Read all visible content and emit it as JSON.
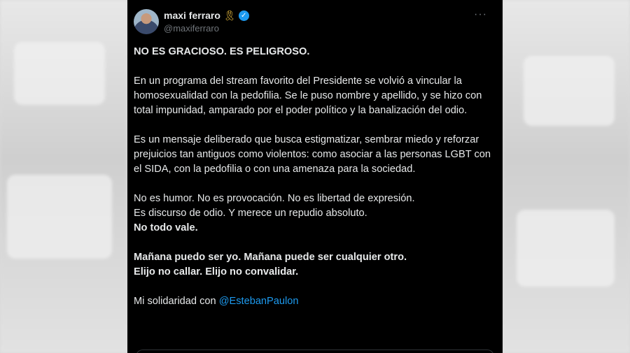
{
  "author": {
    "name": "maxi ferraro",
    "handle": "@maxiferraro",
    "ribbon_icon": "yellow-ribbon-icon",
    "verified_icon": "verified-badge-icon",
    "verified_color": "#1d9bf0"
  },
  "menu": {
    "more_icon": "more-options-icon",
    "glyph": "···"
  },
  "tweet": {
    "headline": "NO ES GRACIOSO. ES PELIGROSO.",
    "p1": "En un programa del stream favorito del Presidente se volvió a vincular la homosexualidad con la pedofilia. Se le puso nombre y apellido, y se hizo con total impunidad, amparado por el poder político y la banalización del odio.",
    "p2": "Es un mensaje deliberado que busca estigmatizar, sembrar miedo y reforzar prejuicios tan antiguos como violentos: como asociar a las personas LGBT con el SIDA, con la pedofilia o con una amenaza para la sociedad.",
    "p3_line1": "No es humor. No es provocación. No es libertad de expresión.",
    "p3_line2": "Es discurso de odio. Y merece un repudio absoluto.",
    "p3_line3": "No todo vale.",
    "p4_line1": "Mañana puedo ser yo. Mañana puede ser cualquier otro.",
    "p4_line2": "Elijo no callar. Elijo no convalidar.",
    "closing_text": "Mi solidaridad con ",
    "mention": "@EstebanPaulon"
  },
  "colors": {
    "background": "#000000",
    "text": "#e7e9ea",
    "secondary": "#71767b",
    "link": "#1d9bf0"
  }
}
